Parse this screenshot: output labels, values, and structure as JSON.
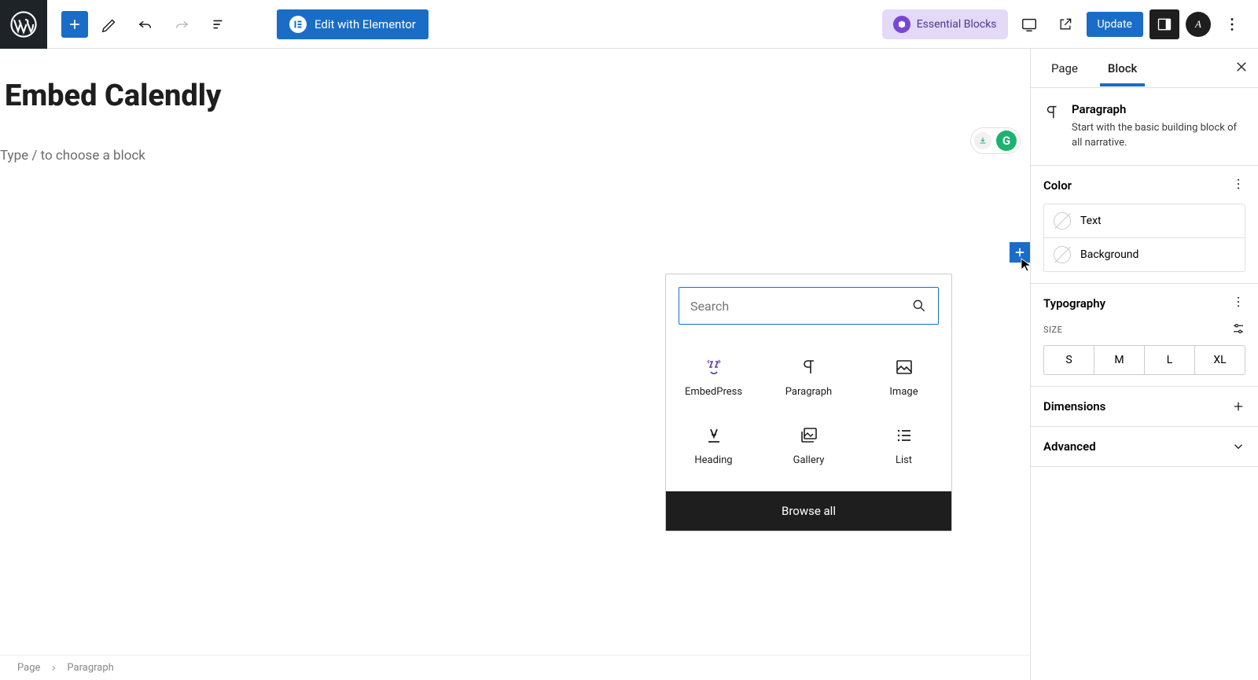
{
  "toolbar": {
    "elementor_label": "Edit with Elementor",
    "essential_blocks_label": "Essential Blocks",
    "update_label": "Update"
  },
  "page": {
    "title": "Embed Calendly",
    "placeholder": "Type / to choose a block"
  },
  "grammarly": {
    "badge": "G"
  },
  "inserter": {
    "search_placeholder": "Search",
    "blocks": [
      {
        "label": "EmbedPress"
      },
      {
        "label": "Paragraph"
      },
      {
        "label": "Image"
      },
      {
        "label": "Heading"
      },
      {
        "label": "Gallery"
      },
      {
        "label": "List"
      }
    ],
    "browse_all": "Browse all"
  },
  "sidebar": {
    "tabs": {
      "page": "Page",
      "block": "Block"
    },
    "block_name": "Paragraph",
    "block_desc": "Start with the basic building block of all narrative.",
    "panels": {
      "color": {
        "title": "Color",
        "items": {
          "text": "Text",
          "background": "Background"
        }
      },
      "typography": {
        "title": "Typography",
        "size_label": "SIZE",
        "sizes": [
          "S",
          "M",
          "L",
          "XL"
        ]
      },
      "dimensions": "Dimensions",
      "advanced": "Advanced"
    }
  },
  "footer": {
    "page": "Page",
    "block": "Paragraph"
  }
}
